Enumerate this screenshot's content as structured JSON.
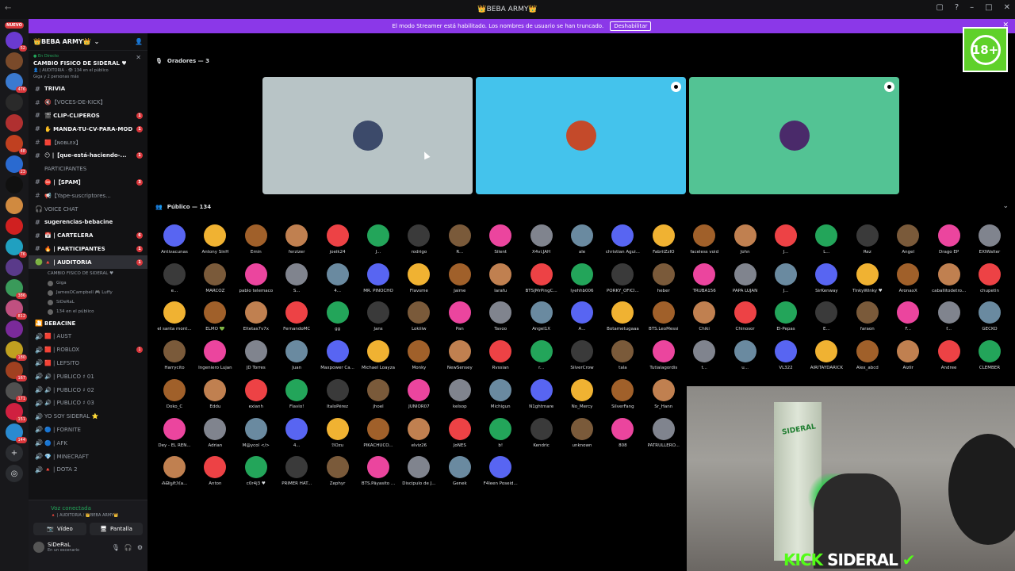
{
  "window_title": "👑BEBA ARMY👑",
  "banner": {
    "text": "El modo Streamer está habilitado. Los nombres de usuario se han truncado.",
    "button": "Deshabilitar"
  },
  "rail": {
    "new_label": "NUEVO",
    "servers": [
      {
        "color": "#6a3ad0",
        "badge": "52"
      },
      {
        "color": "#7a4a2a",
        "badge": ""
      },
      {
        "color": "#3a7ad0",
        "badge": "476"
      },
      {
        "color": "#2a2a2a",
        "badge": ""
      },
      {
        "color": "#b03030",
        "badge": ""
      },
      {
        "color": "#c04020",
        "badge": "48"
      },
      {
        "color": "#2a6ad0",
        "badge": "23"
      },
      {
        "color": "#101010",
        "badge": ""
      },
      {
        "color": "#d08a40",
        "badge": ""
      },
      {
        "color": "#d02020",
        "badge": ""
      },
      {
        "color": "#20a0c0",
        "badge": "76"
      },
      {
        "color": "#5a3a8a",
        "badge": ""
      },
      {
        "color": "#3a9a5a",
        "badge": "386"
      },
      {
        "color": "#c05080",
        "badge": "812"
      },
      {
        "color": "#7a2a9a",
        "badge": ""
      },
      {
        "color": "#c0a020",
        "badge": "180"
      },
      {
        "color": "#a04020",
        "badge": "167"
      },
      {
        "color": "#505050",
        "badge": "171"
      },
      {
        "color": "#d02040",
        "badge": "151"
      },
      {
        "color": "#2a8ad0",
        "badge": "144"
      }
    ]
  },
  "sidebar": {
    "server_name": "👑BEBA ARMY👑",
    "live": {
      "tag": "● En Directo",
      "title": "CAMBIO FISICO DE SIDERAL ♥",
      "line1": "👤 | AUDITORIA · 👁 134 en el público",
      "line2": "Giga y 2 personas más"
    },
    "channels": [
      {
        "icon": "#",
        "label": "TRIVIA",
        "bold": true,
        "unread": ""
      },
      {
        "icon": "#",
        "label": "🔇【VOCES-DE-KICK】",
        "bold": false,
        "unread": ""
      },
      {
        "icon": "#",
        "label": "🎬 CLIP-CLIPEROS",
        "bold": true,
        "unread": "1"
      },
      {
        "icon": "#",
        "label": "✋ MANDA-TU-CV-PARA-MOD",
        "bold": true,
        "unread": "1"
      },
      {
        "icon": "#",
        "label": "🟥【ɴᴏʙʟᴇx】",
        "bold": false,
        "unread": ""
      },
      {
        "icon": "#",
        "label": "😶 |【que-está-haciendo-...",
        "bold": true,
        "unread": "1"
      },
      {
        "icon": "",
        "label": "PARTICIPANTES",
        "bold": false,
        "unread": ""
      },
      {
        "icon": "#",
        "label": "⛔ |【SPAM】",
        "bold": true,
        "unread": "3"
      },
      {
        "icon": "#",
        "label": "📢【Yape-suscriptores...",
        "bold": false,
        "unread": ""
      },
      {
        "icon": "🎧",
        "label": "VOICE CHAT",
        "bold": false,
        "unread": ""
      },
      {
        "icon": "#",
        "label": "sugerencias-bebacine",
        "bold": true,
        "unread": ""
      },
      {
        "icon": "#",
        "label": "📅 | CARTELERA",
        "bold": true,
        "unread": "6"
      },
      {
        "icon": "#",
        "label": "🔥 | PARTICIPANTES",
        "bold": true,
        "unread": "1"
      },
      {
        "icon": "🟢",
        "label": "🔺 | AUDITORIA",
        "bold": true,
        "unread": "1"
      }
    ],
    "auditoria_sub": "CAMBIO FISICO DE SIDERAL ♥",
    "voice_members": [
      "Giga",
      "JamesOCampbell 🎮 Luffy",
      "SiDeRaL",
      "134 en el público"
    ],
    "channels2": [
      {
        "icon": "🎦",
        "label": "BEBACINE",
        "bold": true,
        "unread": ""
      },
      {
        "icon": "🔊",
        "label": "🟥 | AUST",
        "bold": false,
        "unread": ""
      },
      {
        "icon": "🔊",
        "label": "🟥 | ROBLOX",
        "bold": false,
        "unread": "1"
      },
      {
        "icon": "🔊",
        "label": "🟥 | LEFSITO",
        "bold": false,
        "unread": ""
      },
      {
        "icon": "🔊",
        "label": "🔊 | PUBLICO ♯ 01",
        "bold": false,
        "unread": ""
      },
      {
        "icon": "🔊",
        "label": "🔊 | PUBLICO ♯ 02",
        "bold": false,
        "unread": ""
      },
      {
        "icon": "🔊",
        "label": "🔊 | PUBLICO ♯ 03",
        "bold": false,
        "unread": ""
      },
      {
        "icon": "🔊",
        "label": "YO SOY SIDERAL ⭐",
        "bold": false,
        "unread": ""
      },
      {
        "icon": "🔊",
        "label": "🔵 | FORNITE",
        "bold": false,
        "unread": ""
      },
      {
        "icon": "🔊",
        "label": "🔵 | AFK",
        "bold": false,
        "unread": ""
      },
      {
        "icon": "🔊",
        "label": "💎 | MINECRAFT",
        "bold": false,
        "unread": ""
      },
      {
        "icon": "🔊",
        "label": "🔺 | DOTA 2",
        "bold": false,
        "unread": ""
      }
    ],
    "voice": {
      "title": "Voz conectada",
      "sub": "🔺 | AUDITORIA / 👑BEBA ARMY👑",
      "video": "Vídeo",
      "screen": "Pantalla"
    },
    "user": {
      "name": "SiDeRaL",
      "status": "En un escenario"
    }
  },
  "stage": {
    "speakers_label": "Oradores — 3",
    "audience_label": "Público — 134",
    "speakers": [
      {
        "bg": "#b8c4c6",
        "av": "#3c4a6a",
        "cam": false
      },
      {
        "bg": "#44c3ec",
        "av": "#c44a2a",
        "cam": true
      },
      {
        "bg": "#53c394",
        "av": "#4a2a6a",
        "cam": true
      }
    ],
    "audience": [
      [
        "Antivacunas",
        "Antony SinH",
        "Emin",
        "ferzizer",
        "joeik24",
        "J...",
        "rodrigo",
        "R...",
        "Silent",
        "X4vi.JAH",
        "ale",
        "christian Agui...",
        "FabriiZzIO",
        "faceless void",
        "John",
        "J...",
        "L...",
        "Rez",
        "Angel",
        "Drago EP",
        "EXIWalter"
      ],
      [
        "e...",
        "MARCOZ",
        "pablo telemaco",
        "S...",
        "4...",
        "MR. PINOCHO",
        "Flavsme",
        "Jaime",
        "larafu",
        "BTS|MrPingC...",
        "lyehhb006",
        "PORKY_OFICI...",
        "heber",
        "TRUBA156",
        "PAPA LUJAN",
        "J...",
        "SirKenway",
        "TinkyWinky ♥",
        "AronaxX",
        "caballitodetro...",
        "chupetin"
      ],
      [
        "el santa mont...",
        "ELMO 💚",
        "Eltetas7v7x",
        "FernandoMC",
        "gg",
        "Jans",
        "Lokiiiw",
        "Pan",
        "Tavoo",
        "Angel1X",
        "A...",
        "Botametugaaa",
        "BTS.LeoMessi",
        "Chiki",
        "Chinosor",
        "El-Pepas",
        "E...",
        "faraon",
        "F...",
        "f...",
        "GECKO"
      ],
      [
        "Harrycito",
        "Ingeniero Lujan",
        "JD Torres",
        "Juan",
        "Maxpower Ca...",
        "Michael Loayza",
        "Monky",
        "NewSensey",
        "Rvssian",
        "r...",
        "SilverCrow",
        "tala",
        "Tutialagordis",
        "t...",
        "u...",
        "VL322",
        "AIRITAYDARICK",
        "Alex_abcd",
        "Aizlir",
        "Andree",
        "CLEMBER"
      ],
      [
        "Doko_C",
        "Eddu",
        "exianh",
        "Flavio!",
        "ItaloPérez",
        "jhoel",
        "JUNIOR07",
        "kelsop",
        "Michigun",
        "N1ghtmare",
        "No_Mercy",
        "SilverFang",
        "Sr_Hann"
      ],
      [
        "Dey - EL REN...",
        "Adrian",
        "M@ycol </>",
        "4...",
        "ℬOzu",
        "PIKACHUCO...",
        "elviz26",
        "JoNES",
        "b!",
        "Kendric",
        "unknown",
        "808",
        "PATRULLERO..."
      ],
      [
        "⁂ᗷiყℓtℳa...",
        "Anton",
        "c0r4j3 ♥",
        "PRIMER HAT...",
        "Zephyr",
        "BTS.Pãyasito ...",
        "Discípulo de J...",
        "Genek",
        "F4leen Poseid..."
      ]
    ],
    "audience_colors": [
      "#5865f2",
      "#ed4245",
      "#eb459e",
      "#f0b232",
      "#23a55a",
      "#80848e",
      "#a0602a",
      "#3a3a3a",
      "#6a8aa0",
      "#c08050",
      "#7a5a3a"
    ]
  },
  "overlay": {
    "kick_prefix": "KICK",
    "kick_name": "SIDERAL",
    "webcam_sign": "SIDERAL",
    "age_rating": "18+"
  }
}
